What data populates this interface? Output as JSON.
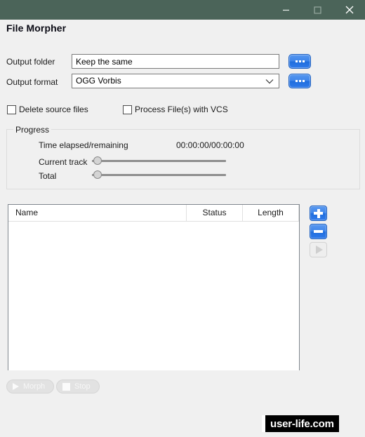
{
  "window": {
    "titlebar_color": "#4b6459",
    "controls": [
      {
        "name": "minimize",
        "glyph": "minimize-icon"
      },
      {
        "name": "maximize",
        "glyph": "maximize-icon"
      },
      {
        "name": "close",
        "glyph": "close-icon"
      }
    ]
  },
  "app": {
    "title": "File Morpher",
    "background": "#f0f0f0",
    "accent": "#2f7aea"
  },
  "form": {
    "output_folder": {
      "label": "Output folder",
      "value": "Keep the same",
      "placeholder": "",
      "browse_label": "..."
    },
    "output_format": {
      "label": "Output format",
      "value": "OGG Vorbis",
      "options": [
        "OGG Vorbis"
      ],
      "browse_label": "..."
    }
  },
  "options": {
    "delete_source": {
      "label": "Delete source files",
      "checked": false
    },
    "process_vcs": {
      "label": "Process File(s) with VCS",
      "checked": false
    }
  },
  "progress": {
    "group_title": "Progress",
    "time_label": "Time elapsed/remaining",
    "time_value": "00:00:00/00:00:00",
    "current_track_label": "Current track",
    "current_track_percent": 0,
    "total_label": "Total",
    "total_percent": 0
  },
  "filelist": {
    "columns": [
      "Name",
      "Status",
      "Length"
    ],
    "rows": []
  },
  "side_actions": {
    "add_label": "+",
    "remove_label": "-",
    "play_label": "play",
    "play_enabled": false
  },
  "footer": {
    "morph_label": "Morph",
    "morph_enabled": false,
    "stop_label": "Stop",
    "stop_enabled": false
  },
  "watermark": {
    "text": "user-life.com"
  }
}
